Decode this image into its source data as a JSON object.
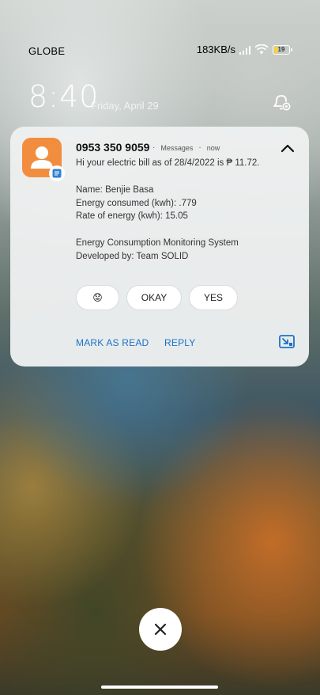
{
  "status_bar": {
    "carrier": "GLOBE",
    "speed": "183KB/s",
    "battery_level": "19",
    "battery_color": "#f5d33a"
  },
  "lockscreen": {
    "time": "8:40",
    "date": "Friday, April 29",
    "alarm_icon": "alarm-settings-icon"
  },
  "notification": {
    "app_icon": "contact-person-icon",
    "badge_icon": "messages-badge-icon",
    "accent_color": "#f28d3f",
    "sender": "0953 350 9059",
    "app_name": "Messages",
    "time": "now",
    "body_lines": [
      "Hi your electric bill as of 28/4/2022 is ₱ 11.72.",
      "Name: Benjie Basa",
      "Energy consumed (kwh): .779",
      "Rate of energy (kwh): 15.05",
      "Energy Consumption Monitoring System",
      "Developed by: Team SOLID"
    ],
    "quick_replies": [
      "😟",
      "OKAY",
      "YES"
    ],
    "actions": {
      "mark_read": "MARK AS READ",
      "reply": "REPLY"
    },
    "link_color": "#1a73c8"
  },
  "dismiss_icon": "close-icon"
}
